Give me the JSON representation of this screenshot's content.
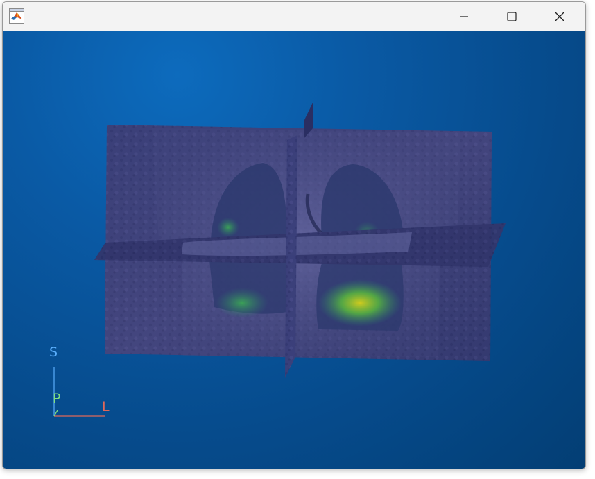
{
  "window": {
    "title": "",
    "controls": {
      "minimize": "minimize",
      "maximize": "maximize",
      "close": "close"
    }
  },
  "orientation_axes": {
    "superior": {
      "label": "S",
      "color": "#5aaefc"
    },
    "posterior": {
      "label": "P",
      "color": "#7fe07f"
    },
    "left": {
      "label": "L",
      "color": "#e0685a"
    }
  },
  "colors": {
    "background_top": "#0d6bbd",
    "background_bottom": "#033e74",
    "titlebar": "#f3f3f3",
    "overlay_hot": "#c9d21a",
    "overlay_warm": "#3fbf4a"
  }
}
